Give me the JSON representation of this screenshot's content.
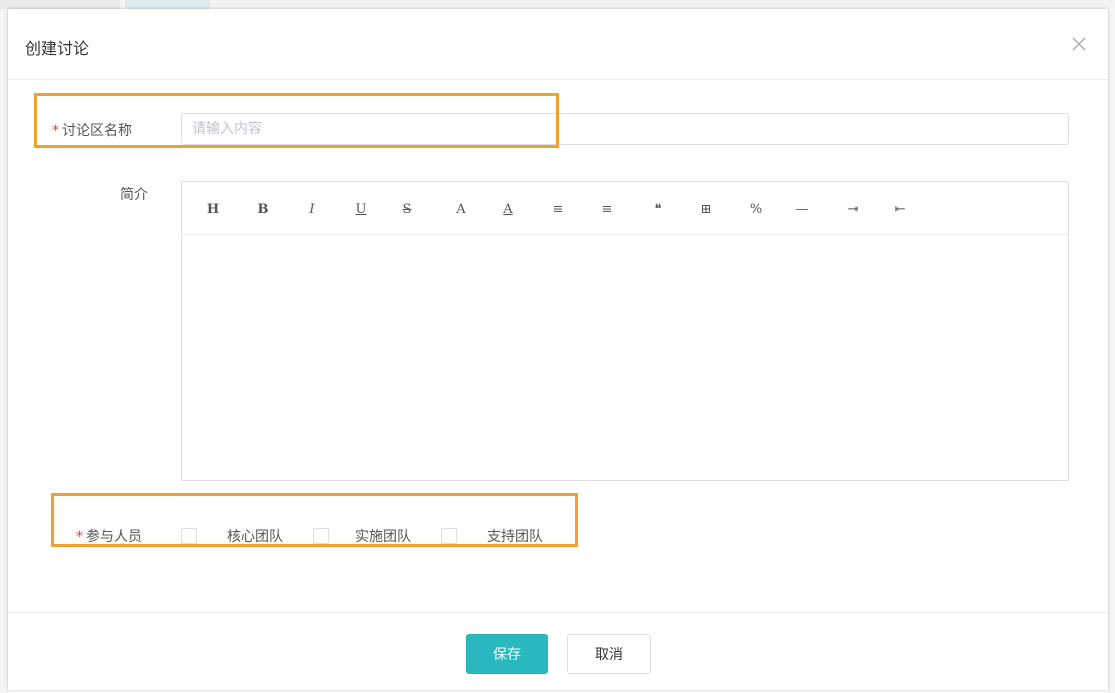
{
  "dialog": {
    "title": "创建讨论",
    "close_icon": "close-icon"
  },
  "form": {
    "name": {
      "required": "*",
      "label": "讨论区名称",
      "placeholder": "请输入内容",
      "value": ""
    },
    "intro": {
      "label": "简介",
      "toolbar": [
        {
          "icon": "heading-icon",
          "glyph": "H"
        },
        {
          "icon": "bold-icon",
          "glyph": "B"
        },
        {
          "icon": "italic-icon",
          "glyph": "I"
        },
        {
          "icon": "underline-icon",
          "glyph": "U"
        },
        {
          "icon": "strikethrough-icon",
          "glyph": "S"
        },
        {
          "icon": "font-color-icon",
          "glyph": "A"
        },
        {
          "icon": "background-color-icon",
          "glyph": "A"
        },
        {
          "icon": "ordered-list-icon",
          "glyph": "≡"
        },
        {
          "icon": "unordered-list-icon",
          "glyph": "≡"
        },
        {
          "icon": "quote-icon",
          "glyph": "❝"
        },
        {
          "icon": "table-icon",
          "glyph": "⊞"
        },
        {
          "icon": "link-icon",
          "glyph": "%"
        },
        {
          "icon": "horizontal-rule-icon",
          "glyph": "—"
        },
        {
          "icon": "indent-icon",
          "glyph": "⇥"
        },
        {
          "icon": "outdent-icon",
          "glyph": "⇤"
        }
      ]
    },
    "participants": {
      "required": "*",
      "label": "参与人员",
      "options": [
        {
          "label": "核心团队",
          "checked": false
        },
        {
          "label": "实施团队",
          "checked": false
        },
        {
          "label": "支持团队",
          "checked": false
        }
      ]
    }
  },
  "footer": {
    "save_label": "保存",
    "cancel_label": "取消"
  },
  "colors": {
    "primary": "#28b8bd",
    "required": "#e4393c",
    "highlight": "#f0a030"
  }
}
